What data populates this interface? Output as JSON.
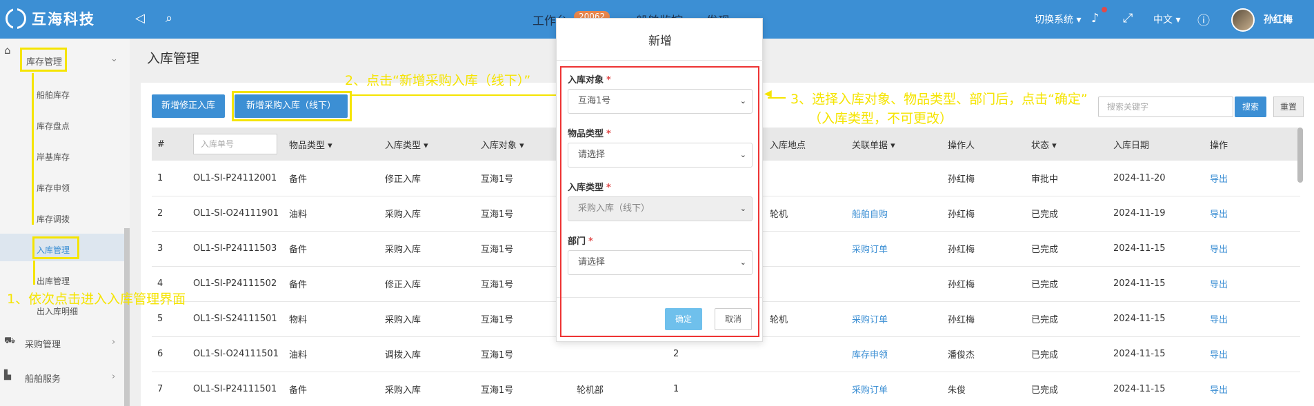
{
  "header": {
    "logo_text": "互海科技",
    "nav": [
      "工作台",
      "船舶监控",
      "发现"
    ],
    "workbench_badge": "20062",
    "switch_system": "切换系统",
    "language": "中文",
    "username": "孙红梅"
  },
  "sidebar": {
    "top_item": "库存管理",
    "sub_items": [
      "船舶库存",
      "库存盘点",
      "岸基库存",
      "库存申领",
      "库存调拨",
      "入库管理",
      "出库管理",
      "出入库明细"
    ],
    "bottom_items": [
      "采购管理",
      "船舶服务"
    ]
  },
  "main": {
    "page_title": "入库管理",
    "btn_fix_in": "新增修正入库",
    "btn_purchase_in": "新增采购入库（线下）",
    "search_placeholder": "搜索关键字",
    "btn_search": "搜索",
    "btn_reset": "重置",
    "filter_placeholder": "入库单号",
    "columns": [
      "#",
      "",
      "物品类型",
      "入库类型",
      "入库对象",
      "",
      "",
      "入库地点",
      "关联单据",
      "操作人",
      "状态",
      "入库日期",
      "操作"
    ],
    "rows": [
      {
        "n": "1",
        "no": "OL1-SI-P24112001",
        "cat": "备件",
        "type": "修正入库",
        "target": "互海1号",
        "dept": "",
        "qty": "",
        "place": "",
        "rel": "",
        "op": "孙红梅",
        "status": "审批中",
        "date": "2024-11-20",
        "action": "导出"
      },
      {
        "n": "2",
        "no": "OL1-SI-O24111901",
        "cat": "油料",
        "type": "采购入库",
        "target": "互海1号",
        "dept": "",
        "qty": "",
        "place": "轮机",
        "rel": "船舶自购",
        "op": "孙红梅",
        "status": "已完成",
        "date": "2024-11-19",
        "action": "导出"
      },
      {
        "n": "3",
        "no": "OL1-SI-P24111503",
        "cat": "备件",
        "type": "采购入库",
        "target": "互海1号",
        "dept": "",
        "qty": "",
        "place": "",
        "rel": "采购订单",
        "op": "孙红梅",
        "status": "已完成",
        "date": "2024-11-15",
        "action": "导出"
      },
      {
        "n": "4",
        "no": "OL1-SI-P24111502",
        "cat": "备件",
        "type": "修正入库",
        "target": "互海1号",
        "dept": "",
        "qty": "",
        "place": "",
        "rel": "",
        "op": "孙红梅",
        "status": "已完成",
        "date": "2024-11-15",
        "action": "导出"
      },
      {
        "n": "5",
        "no": "OL1-SI-S24111501",
        "cat": "物料",
        "type": "采购入库",
        "target": "互海1号",
        "dept": "",
        "qty": "",
        "place": "轮机",
        "rel": "采购订单",
        "op": "孙红梅",
        "status": "已完成",
        "date": "2024-11-15",
        "action": "导出"
      },
      {
        "n": "6",
        "no": "OL1-SI-O24111501",
        "cat": "油料",
        "type": "调拨入库",
        "target": "互海1号",
        "dept": "",
        "qty": "2",
        "place": "",
        "rel": "库存申领",
        "op": "潘俊杰",
        "status": "已完成",
        "date": "2024-11-15",
        "action": "导出"
      },
      {
        "n": "7",
        "no": "OL1-SI-P24111501",
        "cat": "备件",
        "type": "采购入库",
        "target": "互海1号",
        "dept": "轮机部",
        "qty": "1",
        "place": "",
        "rel": "采购订单",
        "op": "朱俊",
        "status": "已完成",
        "date": "2024-11-15",
        "action": "导出"
      }
    ]
  },
  "modal": {
    "title": "新增",
    "f1_label": "入库对象",
    "f1_value": "互海1号",
    "f2_label": "物品类型",
    "f2_value": "请选择",
    "f3_label": "入库类型",
    "f3_value": "采购入库（线下）",
    "f4_label": "部门",
    "f4_value": "请选择",
    "required_mark": "*",
    "ok": "确定",
    "cancel": "取消"
  },
  "annotations": {
    "step1": "1、依次点击进入入库管理界面",
    "step2": "2、点击“新增采购入库（线下）”",
    "step3_line1": "3、选择入库对象、物品类型、部门后，点击“确定”",
    "step3_line2": "（入库类型，不可更改）"
  },
  "colors": {
    "primary": "#3c8fd4",
    "annotation": "#f5e400",
    "highlight_red": "#e33333"
  }
}
